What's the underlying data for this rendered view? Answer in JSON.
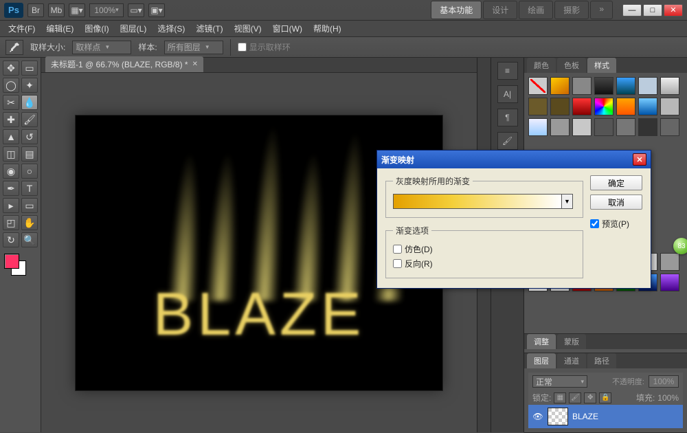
{
  "app": {
    "logo": "Ps",
    "zoom": "100%"
  },
  "workspace_tabs": {
    "active": "基本功能",
    "t2": "设计",
    "t3": "绘画",
    "t4": "摄影"
  },
  "window_controls": {
    "min": "—",
    "max": "□",
    "close": "✕"
  },
  "menu": {
    "file": "文件(F)",
    "edit": "编辑(E)",
    "image": "图像(I)",
    "layer": "图层(L)",
    "select": "选择(S)",
    "filter": "滤镜(T)",
    "view": "视图(V)",
    "window": "窗口(W)",
    "help": "帮助(H)"
  },
  "options": {
    "sample_size_label": "取样大小:",
    "sample_size_value": "取样点",
    "sample_label": "样本:",
    "sample_value": "所有图层",
    "show_ring": "显示取样环"
  },
  "document": {
    "tab": "未标题-1 @ 66.7% (BLAZE, RGB/8) *",
    "artwork_text": "BLAZE"
  },
  "panels": {
    "color_tab1": "颜色",
    "color_tab2": "色板",
    "color_tab3": "样式",
    "adjust_tab1": "调整",
    "adjust_tab2": "蒙版",
    "layer_tab1": "图层",
    "layer_tab2": "通道",
    "layer_tab3": "路径",
    "blend_mode": "正常",
    "opacity_label": "不透明度:",
    "opacity_value": "100%",
    "lock_label": "锁定:",
    "fill_label": "填充:",
    "fill_value": "100%",
    "layer_name": "BLAZE"
  },
  "dialog": {
    "title": "渐变映射",
    "group1": "灰度映射所用的渐变",
    "group2": "渐变选项",
    "dither": "仿色(D)",
    "reverse": "反向(R)",
    "ok": "确定",
    "cancel": "取消",
    "preview": "预览(P)"
  },
  "blob": "83"
}
